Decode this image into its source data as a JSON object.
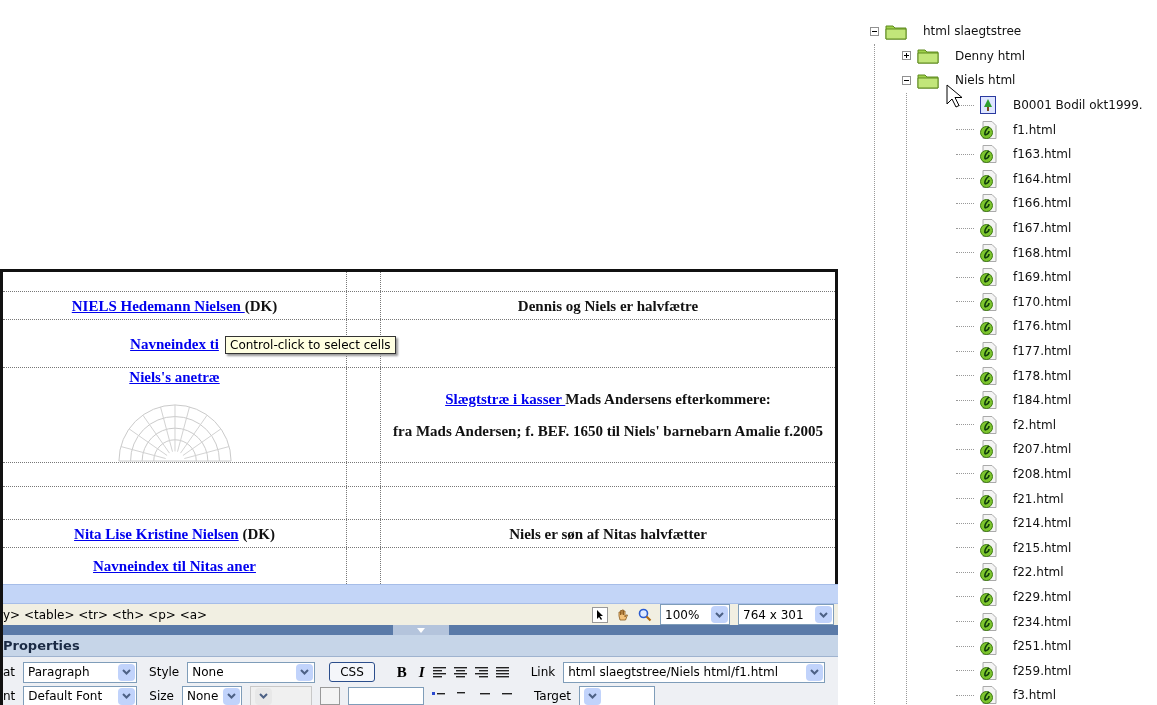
{
  "design_table": {
    "rows": [
      {
        "left": [],
        "right": []
      },
      {
        "left": [
          {
            "kind": "text",
            "parts": [
              {
                "text": "NIELS Hedemann Nielsen ",
                "kind": "link"
              },
              {
                "text": "(DK)",
                "kind": "text"
              }
            ]
          }
        ],
        "right": [
          {
            "kind": "text",
            "parts": [
              {
                "text": "Dennis og Niels er halvfætre",
                "kind": "text"
              }
            ]
          }
        ]
      },
      {
        "left": [
          {
            "kind": "text",
            "parts": [
              {
                "text": "Navneindex ti",
                "kind": "link"
              }
            ]
          }
        ],
        "right": []
      },
      {
        "left": [
          {
            "kind": "text",
            "parts": [
              {
                "text": "Niels's anetræ",
                "kind": "link"
              }
            ]
          },
          {
            "kind": "image"
          }
        ],
        "right": [
          {
            "kind": "text",
            "parts": [
              {
                "text": "Slægtstræ i kasser ",
                "kind": "link"
              },
              {
                "text": "Mads Andersens efterkommere:",
                "kind": "text"
              }
            ]
          },
          {
            "kind": "text",
            "parts": [
              {
                "text": "fra Mads Andersen; f. BEF. 1650 til Niels' barnebarn Amalie f.2005",
                "kind": "text"
              }
            ]
          }
        ]
      },
      {
        "left": [],
        "right": []
      },
      {
        "left": [],
        "right": []
      },
      {
        "left": [
          {
            "kind": "text",
            "parts": [
              {
                "text": "Nita Lise Kristine Nielsen",
                "kind": "link"
              },
              {
                "text": " (DK)",
                "kind": "text"
              }
            ]
          }
        ],
        "right": [
          {
            "kind": "text",
            "parts": [
              {
                "text": "Niels er søn af Nitas halvfætter",
                "kind": "text"
              }
            ]
          }
        ]
      },
      {
        "left": [
          {
            "kind": "text",
            "parts": [
              {
                "text": "Navneindex til Nitas aner",
                "kind": "link"
              }
            ]
          }
        ],
        "right": []
      }
    ],
    "tooltip": {
      "text": "Control-click to select cells"
    }
  },
  "tag_selector": "y> <table> <tr> <th> <p> <a>",
  "zoom": "100%",
  "window_size": "764 x 301",
  "properties": {
    "title": "Properties",
    "format_label": "at",
    "format": "Paragraph",
    "style_label": "Style",
    "style": "None",
    "css_button": "CSS",
    "bold": "B",
    "italic": "I",
    "link_label": "Link",
    "link": "html slaegtstree/Niels html/f1.html",
    "font_label": "nt",
    "font": "Default Font",
    "size_label": "Size",
    "size": "None",
    "target_label": "Target"
  },
  "tree": {
    "label": "html slaegtstree",
    "kind": "folder",
    "expanded": true,
    "children": [
      {
        "label": "Denny html",
        "kind": "folder",
        "expanded": false
      },
      {
        "label": "Niels html",
        "kind": "folder",
        "expanded": true,
        "children": [
          {
            "label": "B0001 Bodil okt1999.",
            "kind": "image"
          },
          {
            "label": "f1.html",
            "kind": "page"
          },
          {
            "label": "f163.html",
            "kind": "page"
          },
          {
            "label": "f164.html",
            "kind": "page"
          },
          {
            "label": "f166.html",
            "kind": "page"
          },
          {
            "label": "f167.html",
            "kind": "page"
          },
          {
            "label": "f168.html",
            "kind": "page"
          },
          {
            "label": "f169.html",
            "kind": "page"
          },
          {
            "label": "f170.html",
            "kind": "page"
          },
          {
            "label": "f176.html",
            "kind": "page"
          },
          {
            "label": "f177.html",
            "kind": "page"
          },
          {
            "label": "f178.html",
            "kind": "page"
          },
          {
            "label": "f184.html",
            "kind": "page"
          },
          {
            "label": "f2.html",
            "kind": "page"
          },
          {
            "label": "f207.html",
            "kind": "page"
          },
          {
            "label": "f208.html",
            "kind": "page"
          },
          {
            "label": "f21.html",
            "kind": "page"
          },
          {
            "label": "f214.html",
            "kind": "page"
          },
          {
            "label": "f215.html",
            "kind": "page"
          },
          {
            "label": "f22.html",
            "kind": "page"
          },
          {
            "label": "f229.html",
            "kind": "page"
          },
          {
            "label": "f234.html",
            "kind": "page"
          },
          {
            "label": "f251.html",
            "kind": "page"
          },
          {
            "label": "f259.html",
            "kind": "page"
          },
          {
            "label": "f3.html",
            "kind": "page"
          }
        ]
      }
    ]
  }
}
